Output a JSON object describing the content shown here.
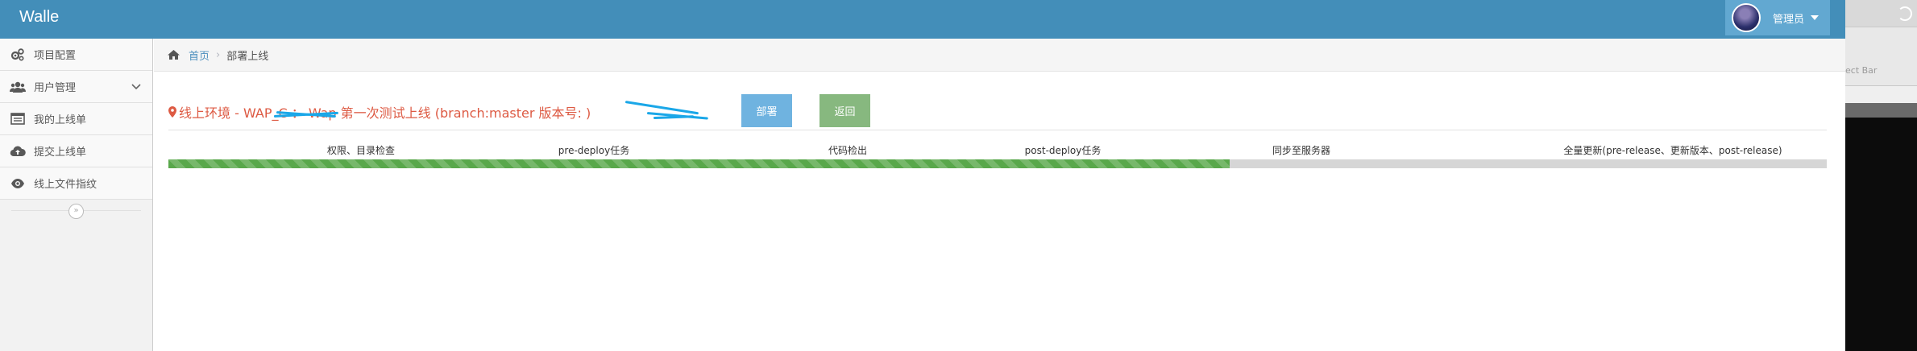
{
  "navbar": {
    "brand": "Walle",
    "user_name": "管理员",
    "colors": {
      "navbar_bg": "#438eb9",
      "user_menu_bg": "#62a8d1"
    }
  },
  "sidebar": {
    "items": [
      {
        "label": "项目配置",
        "icon": "gears-icon"
      },
      {
        "label": "用户管理",
        "icon": "users-icon",
        "has_submenu": true
      },
      {
        "label": "我的上线单",
        "icon": "list-alt-icon"
      },
      {
        "label": "提交上线单",
        "icon": "cloud-upload-icon"
      },
      {
        "label": "线上文件指纹",
        "icon": "eye-icon"
      }
    ],
    "collapse_glyph": "»"
  },
  "breadcrumbs": {
    "home": "首页",
    "current": "部署上线"
  },
  "deploy": {
    "title": "线上环境 - WAP_C        ：  Wap 第一次测试上线   (branch:master 版本号:               )",
    "deploy_button": "部署",
    "back_button": "返回",
    "progress_percent": 64,
    "steps": [
      "权限、目录检查",
      "pre-deploy任务",
      "代码检出",
      "post-deploy任务",
      "同步至服务器",
      "全量更新(pre-release、更新版本、post-release)"
    ]
  },
  "desktop": {
    "side_text": "ect Bar"
  },
  "colors": {
    "title_red": "#dd5a43",
    "deploy_btn": "#6fb3e0",
    "back_btn": "#87b87f",
    "progress_green": "#59a84b",
    "redaction": "#1aa7e8"
  }
}
